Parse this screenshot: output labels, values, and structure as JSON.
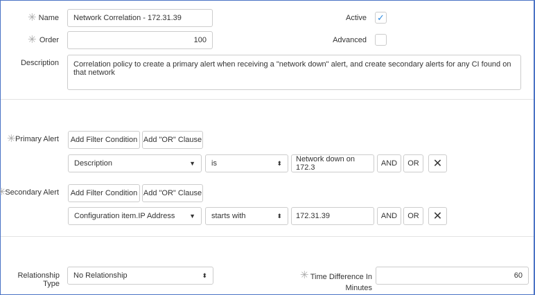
{
  "form": {
    "name": {
      "label": "Name",
      "value": "Network Correlation - 172.31.39",
      "required": true
    },
    "order": {
      "label": "Order",
      "value": "100",
      "required": true
    },
    "description": {
      "label": "Description",
      "value": "Correlation policy to create a primary alert when receiving a \"network down\" alert, and create secondary alerts for any CI found on that network"
    },
    "active": {
      "label": "Active",
      "checked": true
    },
    "advanced": {
      "label": "Advanced",
      "checked": false
    }
  },
  "filters": {
    "add_filter_label": "Add Filter Condition",
    "add_or_label": "Add \"OR\" Clause",
    "and_label": "AND",
    "or_label": "OR",
    "remove_icon": "close-icon",
    "primary": {
      "label": "Primary Alert",
      "field": "Description",
      "operator": "is",
      "value": "Network down on 172.3"
    },
    "secondary": {
      "label": "Secondary Alert",
      "field": "Configuration item.IP Address",
      "operator": "starts with",
      "value": "172.31.39"
    }
  },
  "relationship": {
    "label": "Relationship Type",
    "value": "No Relationship"
  },
  "time_difference": {
    "label_line1": "Time Difference In",
    "label_line2": "Minutes",
    "value": "60",
    "required": true
  },
  "colors": {
    "accent": "#2d8ae0",
    "frame": "#4a72c4"
  }
}
